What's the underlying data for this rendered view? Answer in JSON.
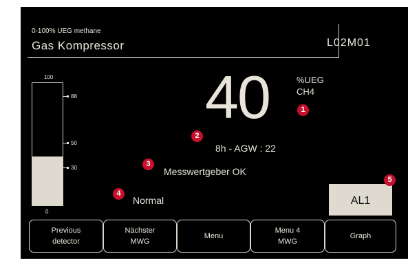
{
  "header": {
    "subtitle": "0-100% UEG methane",
    "title": "Gas Kompressor",
    "detector_id": "L02M01"
  },
  "bargraph": {
    "max_label": "100",
    "min_label": "0",
    "level_fraction": 0.4,
    "ticks": [
      {
        "label": "88",
        "value": 88
      },
      {
        "label": "50",
        "value": 50
      },
      {
        "label": "30",
        "value": 30
      }
    ]
  },
  "reading": {
    "value": "40",
    "unit_line1": "%UEG",
    "unit_line2": "CH4"
  },
  "agw": "8h - AGW : 22",
  "status": {
    "transmitter": "Messwertgeber OK",
    "state": "Normal"
  },
  "alarm": {
    "label": "AL1"
  },
  "markers": [
    "1",
    "2",
    "3",
    "4",
    "5"
  ],
  "softkeys": [
    "Previous\ndetector",
    "Nächster\nMWG",
    "Menu",
    "Menu 4\nMWG",
    "Graph"
  ],
  "colors": {
    "screen_bg": "#000000",
    "foreground": "#e8e4da",
    "marker": "#c8102e",
    "alarm_bg": "#dedad0"
  }
}
